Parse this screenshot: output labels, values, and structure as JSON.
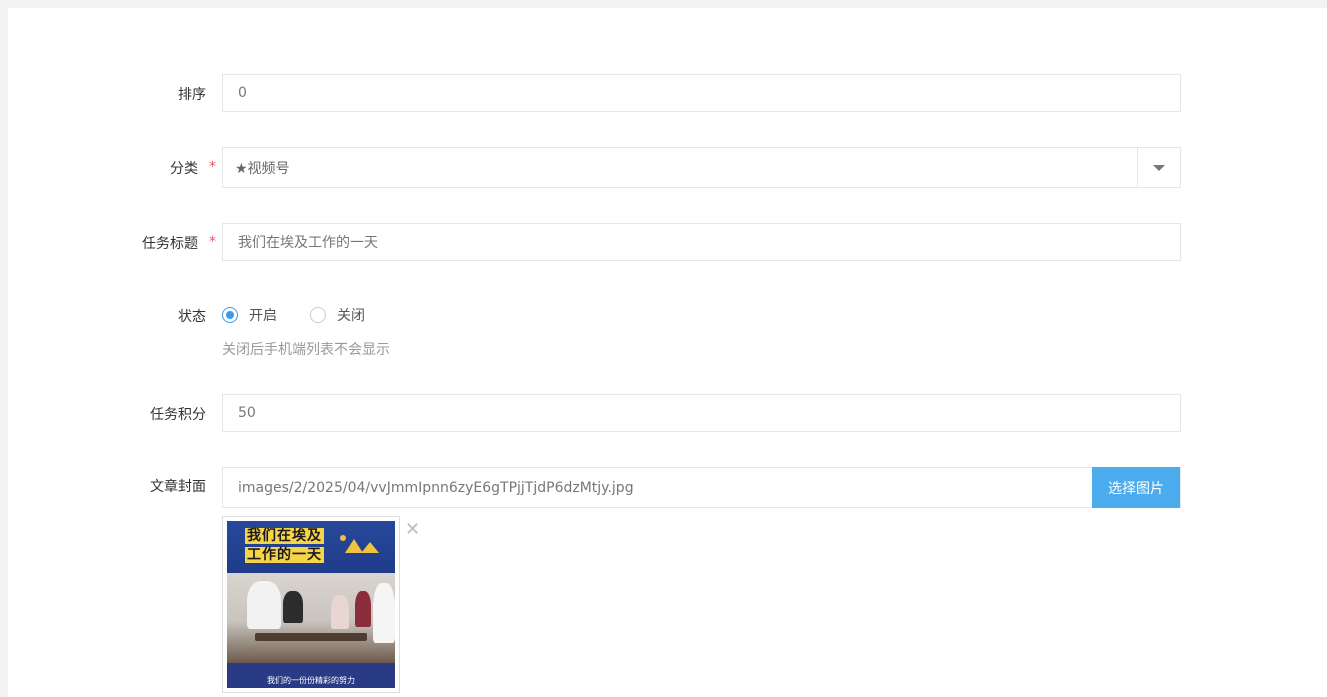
{
  "form": {
    "sort": {
      "label": "排序",
      "value": "0"
    },
    "category": {
      "label": "分类",
      "required_mark": "*",
      "value": "★视频号"
    },
    "title": {
      "label": "任务标题",
      "required_mark": "*",
      "value": "我们在埃及工作的一天"
    },
    "status": {
      "label": "状态",
      "options": [
        "开启",
        "关闭"
      ],
      "selected": "开启",
      "help": "关闭后手机端列表不会显示"
    },
    "points": {
      "label": "任务积分",
      "value": "50"
    },
    "cover": {
      "label": "文章封面",
      "value": "images/2/2025/04/vvJmmIpnn6zyE6gTPjjTjdP6dzMtjy.jpg",
      "button_label": "选择图片",
      "remove_icon": "close-icon",
      "thumbnail": {
        "title_line1": "我们在埃及",
        "title_line2": "工作的一天",
        "caption": "我们的一份份精彩的努力"
      }
    }
  },
  "colors": {
    "accent": "#4aacee",
    "radio": "#3d98f0",
    "required": "#ed5565"
  }
}
